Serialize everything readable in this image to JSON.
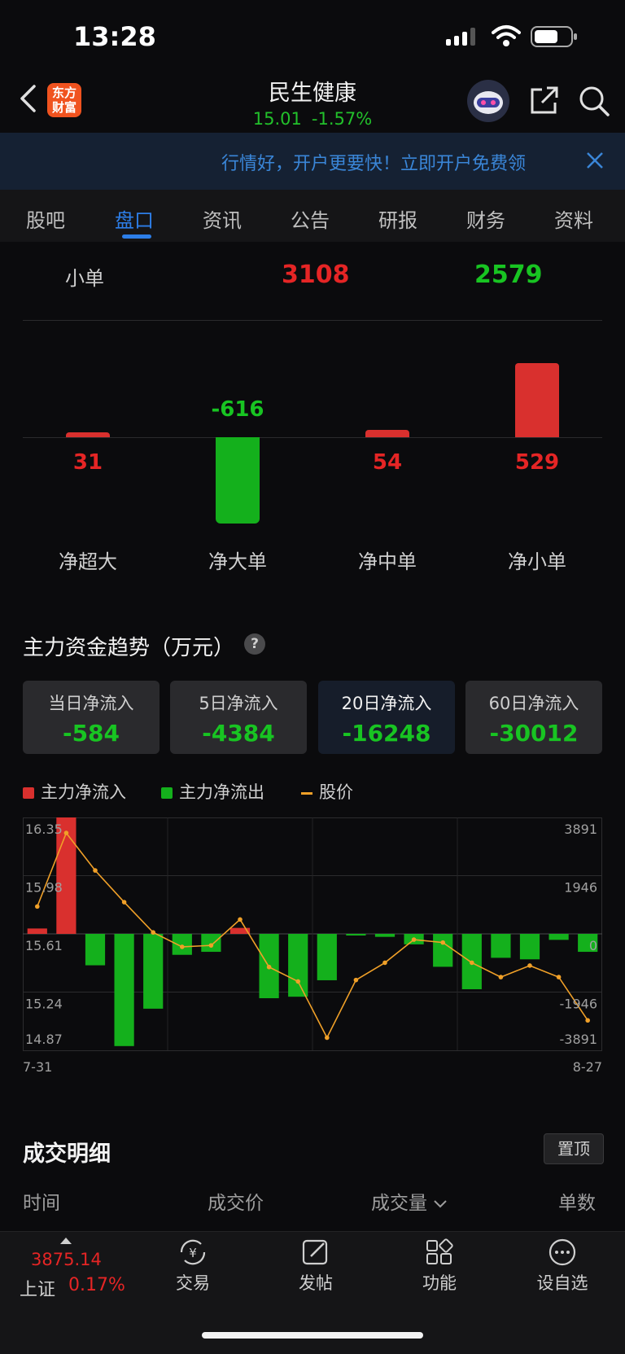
{
  "status_bar": {
    "time": "13:28"
  },
  "header": {
    "logo_text_line1": "东方",
    "logo_text_line2": "财富",
    "stock_name": "民生健康",
    "price": "15.01",
    "change_pct": "-1.57%"
  },
  "banner": {
    "text": "行情好，开户更要快！立即开户免费领"
  },
  "tabs": [
    {
      "label": "股吧",
      "active": false
    },
    {
      "label": "盘口",
      "active": true
    },
    {
      "label": "资讯",
      "active": false
    },
    {
      "label": "公告",
      "active": false
    },
    {
      "label": "研报",
      "active": false
    },
    {
      "label": "财务",
      "active": false
    },
    {
      "label": "资料",
      "active": false
    }
  ],
  "small_order_row": {
    "label": "小单",
    "inflow": "3108",
    "outflow": "2579"
  },
  "net_orders": [
    {
      "label": "净超大",
      "value": 31,
      "value_text": "31",
      "color": "#d9302e"
    },
    {
      "label": "净大单",
      "value": -616,
      "value_text": "-616",
      "color": "#14b01c"
    },
    {
      "label": "净中单",
      "value": 54,
      "value_text": "54",
      "color": "#d9302e"
    },
    {
      "label": "净小单",
      "value": 529,
      "value_text": "529",
      "color": "#d9302e"
    }
  ],
  "trend_section": {
    "title": "主力资金趋势（万元）",
    "help": "?",
    "cards": [
      {
        "label": "当日净流入",
        "value": "-584",
        "selected": false
      },
      {
        "label": "5日净流入",
        "value": "-4384",
        "selected": false
      },
      {
        "label": "20日净流入",
        "value": "-16248",
        "selected": true
      },
      {
        "label": "60日净流入",
        "value": "-30012",
        "selected": false
      }
    ],
    "legend": [
      {
        "label": "主力净流入",
        "color": "#d9302e"
      },
      {
        "label": "主力净流出",
        "color": "#14b01c"
      },
      {
        "label": "股价",
        "color": "#f0a028"
      }
    ]
  },
  "chart_data": {
    "type": "bar",
    "x_start_label": "7-31",
    "x_end_label": "8-27",
    "left_axis_ticks": [
      "16.35",
      "15.98",
      "15.61",
      "15.24",
      "14.87"
    ],
    "right_axis_ticks": [
      "3891",
      "1946",
      "0",
      "-1946",
      "-3891"
    ],
    "price_range": [
      14.87,
      16.35
    ],
    "flow_range": [
      -3891,
      3891
    ],
    "series": [
      {
        "name": "主力净流入/流出",
        "values": [
          180,
          3900,
          -1050,
          -3750,
          -2500,
          -700,
          -600,
          200,
          -2150,
          -2100,
          -1550,
          -50,
          -100,
          -350,
          -1100,
          -1850,
          -800,
          -850,
          -200,
          -600
        ]
      },
      {
        "name": "股价",
        "values": [
          15.8,
          16.31,
          16.05,
          15.83,
          15.62,
          15.52,
          15.53,
          15.71,
          15.38,
          15.28,
          14.89,
          15.29,
          15.41,
          15.57,
          15.55,
          15.41,
          15.31,
          15.39,
          15.31,
          15.01
        ]
      }
    ]
  },
  "detail": {
    "title": "成交明细",
    "pin_label": "置顶",
    "columns": [
      "时间",
      "成交价",
      "成交量",
      "单数"
    ]
  },
  "bottom_bar": {
    "index_value": "3875.14",
    "index_name": "上证",
    "index_pct": "0.17%",
    "items": [
      {
        "label": "交易",
        "icon": "yuan-exchange-icon"
      },
      {
        "label": "发帖",
        "icon": "edit-post-icon"
      },
      {
        "label": "功能",
        "icon": "grid-function-icon"
      },
      {
        "label": "设自选",
        "icon": "more-dots-icon"
      }
    ]
  }
}
